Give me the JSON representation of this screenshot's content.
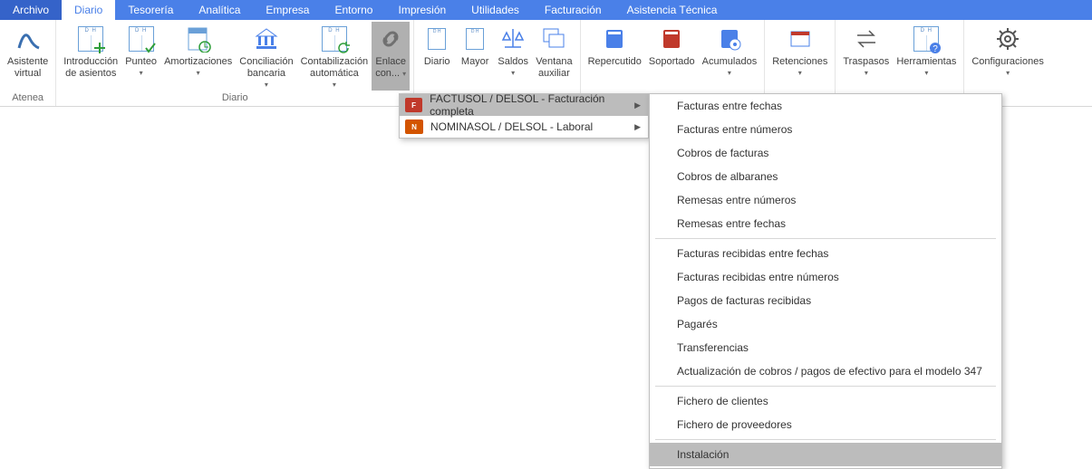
{
  "colors": {
    "menubar": "#4a80e8",
    "archivo": "#3563c9",
    "active_tab_fg": "#4a80e8",
    "ribbon_border": "#d7d7d7",
    "flyout_hover": "#bcbcbc"
  },
  "tabs": [
    {
      "label": "Archivo",
      "style": "archivo"
    },
    {
      "label": "Diario",
      "style": "active"
    },
    {
      "label": "Tesorería"
    },
    {
      "label": "Analítica"
    },
    {
      "label": "Empresa"
    },
    {
      "label": "Entorno"
    },
    {
      "label": "Impresión"
    },
    {
      "label": "Utilidades"
    },
    {
      "label": "Facturación"
    },
    {
      "label": "Asistencia Técnica"
    }
  ],
  "ribbon": {
    "groups": {
      "atenea": {
        "label": "Atenea"
      },
      "diario": {
        "label": "Diario"
      }
    },
    "buttons": {
      "asistente": {
        "l1": "Asistente",
        "l2": "virtual"
      },
      "introduccion": {
        "l1": "Introducción",
        "l2": "de asientos"
      },
      "punteo": {
        "l1": "Punteo"
      },
      "amortizaciones": {
        "l1": "Amortizaciones"
      },
      "conciliacion": {
        "l1": "Conciliación",
        "l2": "bancaria"
      },
      "contabilizacion": {
        "l1": "Contabilización",
        "l2": "automática"
      },
      "enlace": {
        "l1": "Enlace",
        "l2": "con..."
      },
      "diario_btn": {
        "l1": "Diario"
      },
      "mayor": {
        "l1": "Mayor"
      },
      "saldos": {
        "l1": "Saldos"
      },
      "ventana": {
        "l1": "Ventana",
        "l2": "auxiliar"
      },
      "repercutido": {
        "l1": "Repercutido"
      },
      "soportado": {
        "l1": "Soportado"
      },
      "acumulados": {
        "l1": "Acumulados"
      },
      "retenciones": {
        "l1": "Retenciones"
      },
      "traspasos": {
        "l1": "Traspasos"
      },
      "herramientas": {
        "l1": "Herramientas"
      },
      "configuraciones": {
        "l1": "Configuraciones"
      }
    }
  },
  "flyout1": {
    "items": [
      {
        "icon_color": "#c0392b",
        "icon_text": "F",
        "label": "FACTUSOL / DELSOL - Facturación completa",
        "hovered": true
      },
      {
        "icon_color": "#d35400",
        "icon_text": "N",
        "label": "NOMINASOL / DELSOL - Laboral",
        "hovered": false
      }
    ]
  },
  "flyout2": {
    "groups": [
      [
        "Facturas entre fechas",
        "Facturas entre números",
        "Cobros de facturas",
        "Cobros de albaranes",
        "Remesas entre números",
        "Remesas entre fechas"
      ],
      [
        "Facturas recibidas entre fechas",
        "Facturas recibidas entre números",
        "Pagos de facturas recibidas",
        "Pagarés",
        "Transferencias",
        "Actualización de cobros / pagos de efectivo para el modelo 347"
      ],
      [
        "Fichero de clientes",
        "Fichero de proveedores"
      ],
      [
        "Instalación"
      ]
    ],
    "hovered": "Instalación"
  }
}
